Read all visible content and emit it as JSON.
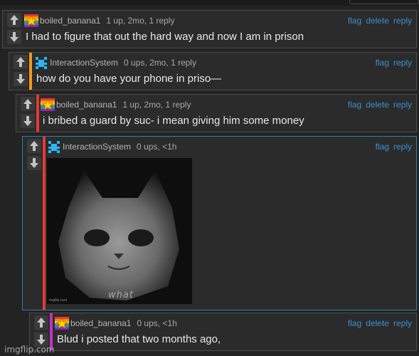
{
  "actions": {
    "flag": "flag",
    "delete": "delete",
    "reply": "reply"
  },
  "comments": [
    {
      "user": "boiled_banana1",
      "meta": "1 up, 2mo, 1 reply",
      "text": "I had to figure that out the hard way and now I am in prison",
      "bar_color": ""
    },
    {
      "user": "InteractionSystem",
      "meta": "0 ups, 2mo, 1 reply",
      "text": "how do you have your phone in priso—",
      "bar_color": "#f09a1a"
    },
    {
      "user": "boiled_banana1",
      "meta": "1 up, 2mo, 1 reply",
      "text": "i bribed a guard by suc- i mean giving him some money",
      "bar_color": "#e33b36"
    },
    {
      "user": "InteractionSystem",
      "meta": "0 ups, <1h",
      "text": "",
      "bar_color": "#e33b36",
      "meme_caption": "what",
      "meme_watermark": "imgflip.com"
    },
    {
      "user": "boiled_banana1",
      "meta": "0 ups, <1h",
      "text": "Blud i posted that two months ago,",
      "bar_color": "#c531c6"
    }
  ],
  "watermark": "imgflip.com",
  "colors": {
    "accent_link": "#3a8fd1",
    "background": "#232323",
    "card": "#2b2b2b"
  }
}
